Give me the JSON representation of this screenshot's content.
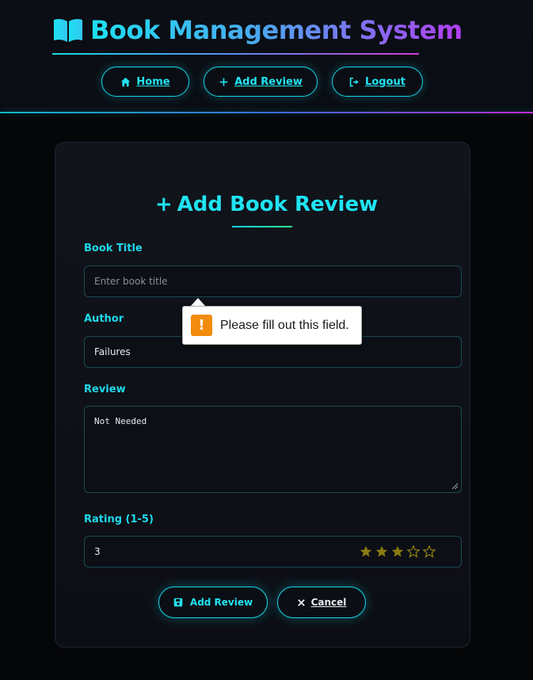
{
  "header": {
    "app_title": "Book Management System",
    "nav": {
      "home_label": "Home",
      "add_review_label": "Add Review",
      "logout_label": "Logout"
    }
  },
  "form": {
    "title": "Add Book Review",
    "title_plus": "+",
    "book_title": {
      "label": "Book Title",
      "placeholder": "Enter book title",
      "value": ""
    },
    "author": {
      "label": "Author",
      "value": "Failures"
    },
    "review": {
      "label": "Review",
      "value": "Not Needed"
    },
    "rating": {
      "label": "Rating (1-5)",
      "value": "3",
      "stars_filled": 3,
      "stars_total": 5
    },
    "submit_label": "Add Review",
    "cancel_label": "Cancel"
  },
  "tooltip": {
    "icon": "!",
    "message": "Please fill out this field."
  },
  "colors": {
    "accent": "#1fe3f2",
    "star": "#8a7a12",
    "warning": "#f28c0d"
  }
}
